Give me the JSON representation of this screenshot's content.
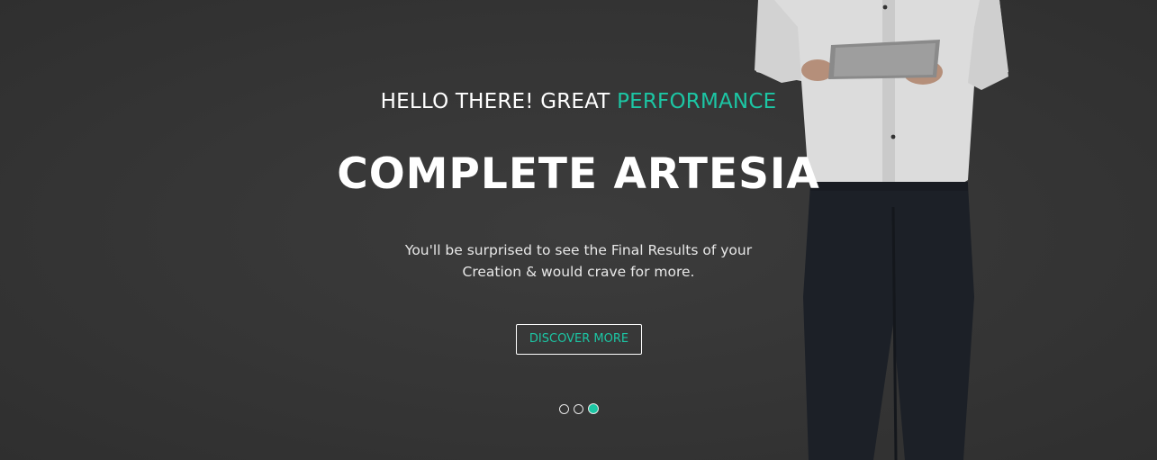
{
  "hero": {
    "eyebrow_prefix": "HELLO THERE! GREAT",
    "eyebrow_accent": "PERFORMANCE",
    "title": "COMPLETE ARTESIA",
    "description_line1": "You'll be surprised to see the Final Results of your",
    "description_line2": "Creation & would crave for more.",
    "cta_label": "DISCOVER MORE"
  },
  "carousel": {
    "slide_count": 3,
    "active_slide": 3
  },
  "colors": {
    "accent": "#1cc6a4",
    "background": "#353535",
    "text": "#ffffff"
  }
}
